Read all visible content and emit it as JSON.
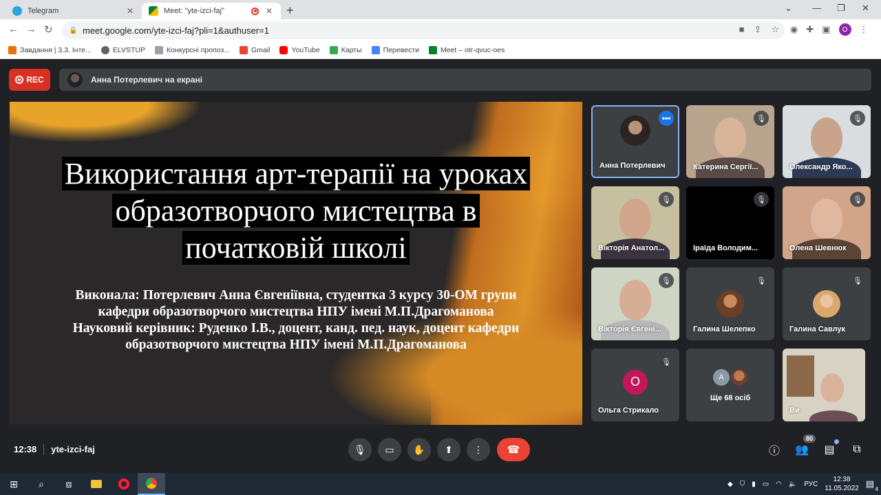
{
  "browser": {
    "tabs": [
      {
        "title": "Telegram",
        "active": false
      },
      {
        "title": "Meet: \"yte-izci-faj\"",
        "active": true
      }
    ],
    "url": "meet.google.com/yte-izci-faj?pli=1&authuser=1",
    "profile_initial": "O",
    "bookmarks": [
      {
        "label": "Завдання | 3.3. Інте...",
        "icon": "bookmark-orange"
      },
      {
        "label": "ELVSTUP",
        "icon": "globe-icon"
      },
      {
        "label": "Конкурсні пропоз...",
        "icon": "puzzle-icon"
      },
      {
        "label": "Gmail",
        "icon": "gmail-icon"
      },
      {
        "label": "YouTube",
        "icon": "youtube-icon"
      },
      {
        "label": "Карты",
        "icon": "maps-icon"
      },
      {
        "label": "Перевести",
        "icon": "translate-icon"
      },
      {
        "label": "Meet – otr-qvuc-oes",
        "icon": "meet-icon"
      }
    ]
  },
  "meet": {
    "rec_label": "REC",
    "presenting_label": "Анна Потерлевич на екрані",
    "slide": {
      "title_lines": [
        "Використання арт-терапії на уроках",
        "образотворчого мистецтва в",
        "початковій школі"
      ],
      "subtitle_lines": [
        "Виконала: Потерлевич Анна Євгеніївна, студентка 3 курсу 30-ОМ групи",
        "кафедри образотворчого мистецтва НПУ імені М.П.Драгоманова",
        "Науковий керівник: Руденко І.В., доцент, канд. пед. наук, доцент кафедри",
        "образотворчого мистецтва НПУ імені М.П.Драгоманова"
      ]
    },
    "participants": [
      {
        "name": "Анна Потерлевич"
      },
      {
        "name": "Катерина Сергії..."
      },
      {
        "name": "Олександр Яко..."
      },
      {
        "name": "Вікторія Анатол..."
      },
      {
        "name": "Іраїда Володим..."
      },
      {
        "name": "Олена Шевнюк"
      },
      {
        "name": "Вікторія Євгені..."
      },
      {
        "name": "Галина Шелепко"
      },
      {
        "name": "Галина Савлук"
      },
      {
        "name": "Ольга Стрикало",
        "initial": "О"
      },
      {
        "name": "Ще 68 осіб",
        "initial": "A"
      },
      {
        "name": "Ви"
      }
    ],
    "time": "12:38",
    "meeting_code": "yte-izci-faj",
    "people_count": "80"
  },
  "taskbar": {
    "language": "РУС",
    "time": "12:38",
    "date": "11.05.2022",
    "notifications": "4"
  },
  "colors": {
    "meet_bg": "#202124",
    "tile_bg": "#3c4043",
    "rec_red": "#d93025",
    "end_call": "#ea4335",
    "accent_blue": "#1a73e8"
  }
}
